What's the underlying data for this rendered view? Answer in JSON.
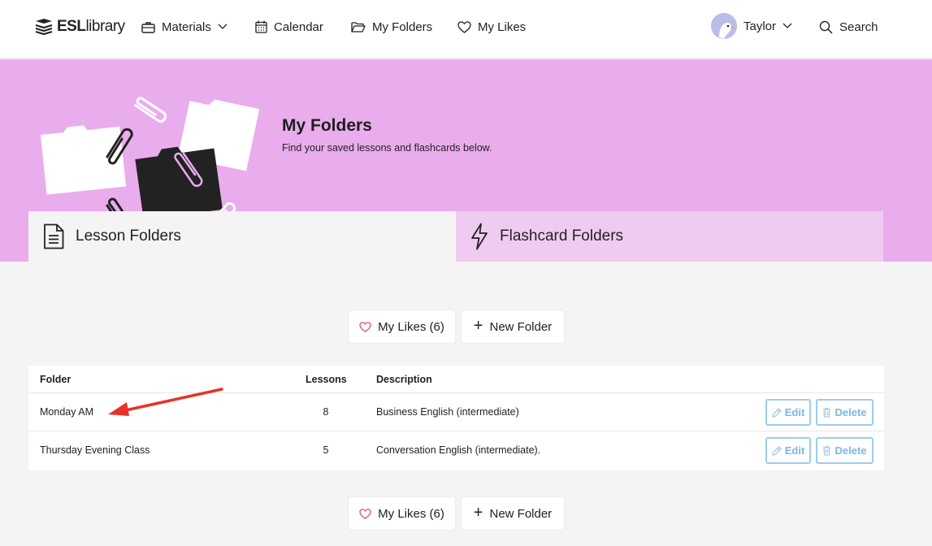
{
  "nav": {
    "logo_bold": "ESL",
    "logo_light": "library",
    "materials": "Materials",
    "calendar": "Calendar",
    "my_folders": "My Folders",
    "my_likes": "My Likes",
    "user_name": "Taylor",
    "search": "Search"
  },
  "hero": {
    "title": "My Folders",
    "subtitle": "Find your saved lessons and flashcards below."
  },
  "tabs": {
    "lesson": "Lesson Folders",
    "flashcard": "Flashcard Folders"
  },
  "actions": {
    "my_likes": "My Likes (6)",
    "new_folder": "New Folder"
  },
  "table": {
    "headers": {
      "folder": "Folder",
      "lessons": "Lessons",
      "description": "Description"
    },
    "rows": [
      {
        "folder": "Monday AM",
        "lessons": "8",
        "description": "Business English (intermediate)"
      },
      {
        "folder": "Thursday Evening Class",
        "lessons": "5",
        "description": "Conversation English (intermediate)."
      }
    ],
    "edit_label": "Edit",
    "delete_label": "Delete"
  },
  "colors": {
    "hero_bg": "#e9acec",
    "flash_tab_bg": "#f0cbf1",
    "button_outline": "#9ecde9",
    "heart": "#e24a86",
    "annotation_arrow": "#e8322a"
  },
  "icons": [
    "esl-library-logo-icon",
    "briefcase-icon",
    "calendar-icon",
    "folder-icon",
    "heart-icon",
    "chevron-down-icon",
    "avatar",
    "search-icon",
    "document-icon",
    "lightning-icon",
    "pencil-icon",
    "trash-icon",
    "plus-icon"
  ]
}
